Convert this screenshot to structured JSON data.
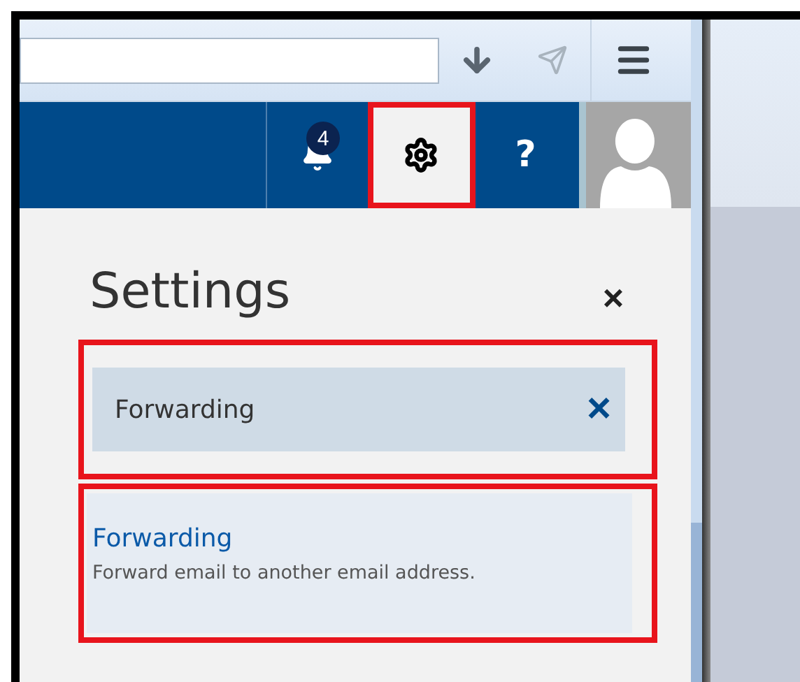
{
  "nav": {
    "notifications": {
      "badge": "4"
    },
    "settings_button": {
      "selected": true,
      "highlighted": true
    },
    "help": {
      "label": "?"
    }
  },
  "panel": {
    "title": "Settings",
    "close": "×",
    "search": {
      "value": "Forwarding",
      "clear": "×",
      "highlighted": true
    },
    "results": [
      {
        "title": "Forwarding",
        "description": "Forward email to another email address.",
        "highlighted": true
      }
    ]
  }
}
